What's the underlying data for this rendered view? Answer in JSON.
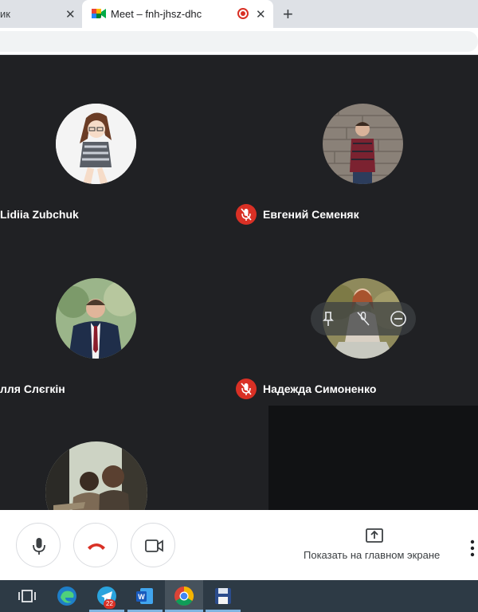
{
  "browser": {
    "tabs": [
      {
        "label": "ик",
        "close": "✕"
      },
      {
        "label": "Meet – fnh-jhsz-dhc",
        "close": "✕",
        "favicon": "google-meet-icon",
        "recording": true
      }
    ],
    "new_tab": "+"
  },
  "participants": [
    {
      "name": "Lidiia Zubchuk",
      "avatar": "anime-girl-avatar",
      "muted": false
    },
    {
      "name": "Евгений Семеняк",
      "avatar": "man-brick-wall-avatar",
      "muted": true
    },
    {
      "name": "лля Слєгкін",
      "avatar": "man-in-suit-avatar",
      "muted": false
    },
    {
      "name": "Надежда Симоненко",
      "avatar": "woman-outdoor-avatar",
      "muted": true
    },
    {
      "name": "",
      "avatar": "group-photo-avatar",
      "muted": false
    }
  ],
  "hover_controls": [
    "pin-icon",
    "mic-off-icon",
    "remove-icon"
  ],
  "controls": {
    "mic": "microphone-icon",
    "hangup": "phone-hangup-icon",
    "camera": "camera-icon",
    "present_label": "Показать на главном экране",
    "present_icon": "present-screen-icon",
    "more": "more-vert-icon"
  },
  "taskbar": {
    "icons": [
      "task-view-icon",
      "edge-icon",
      "telegram-icon",
      "word-icon",
      "chrome-icon",
      "save-app-icon"
    ],
    "telegram_badge": "22",
    "active": "chrome-icon"
  },
  "colors": {
    "accent_red": "#d93025",
    "meet_bg": "#202124"
  }
}
